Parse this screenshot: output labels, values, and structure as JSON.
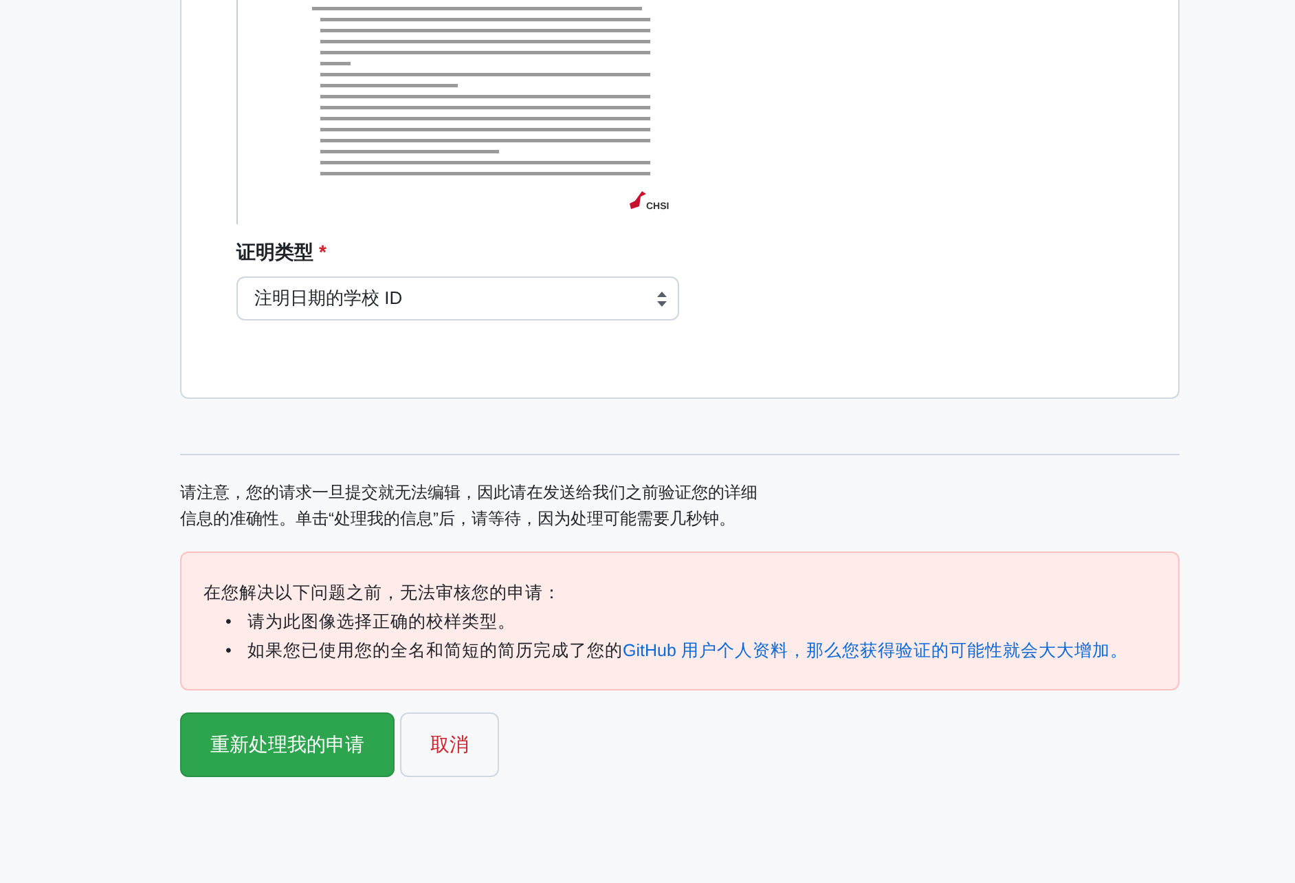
{
  "document_preview": {
    "logo_text": "CHSI"
  },
  "field": {
    "label": "证明类型",
    "required_mark": "*",
    "value": "注明日期的学校 ID"
  },
  "notice": "请注意，您的请求一旦提交就无法编辑，因此请在发送给我们之前验证您的详细信息的准确性。单击“处理我的信息”后，请等待，因为处理可能需要几秒钟。",
  "alert": {
    "heading": "在您解决以下问题之前，无法审核您的申请：",
    "items": [
      {
        "marker": "•",
        "text": "请为此图像选择正确的校样类型。"
      },
      {
        "marker": "•",
        "text": "如果您已使用您的全名和简短的简历完成了您的",
        "link": "GitHub 用户个人资料，那么您获得验证的可能性就会大大增加。"
      }
    ]
  },
  "buttons": [
    {
      "label": "重新处理我的申请",
      "kind": "primary"
    },
    {
      "label": "取消",
      "kind": "cancel"
    }
  ]
}
